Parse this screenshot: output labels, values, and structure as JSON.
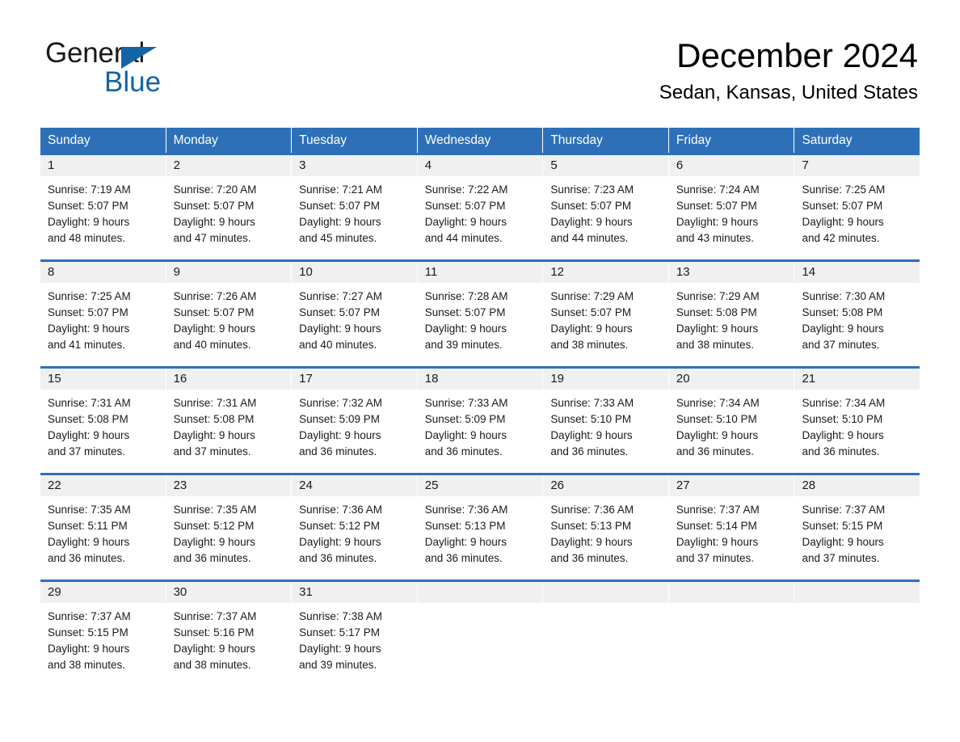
{
  "brand": {
    "name_part1": "General",
    "name_part2": "Blue",
    "accent_color": "#1464a5",
    "triangle_icon": "triangle-icon"
  },
  "header": {
    "month_title": "December 2024",
    "location": "Sedan, Kansas, United States"
  },
  "calendar": {
    "header_color": "#2e70b8",
    "day_band_color": "#f0f0f0",
    "weekdays": [
      "Sunday",
      "Monday",
      "Tuesday",
      "Wednesday",
      "Thursday",
      "Friday",
      "Saturday"
    ],
    "weeks": [
      [
        {
          "day": "1",
          "lines": [
            "Sunrise: 7:19 AM",
            "Sunset: 5:07 PM",
            "Daylight: 9 hours",
            "and 48 minutes."
          ]
        },
        {
          "day": "2",
          "lines": [
            "Sunrise: 7:20 AM",
            "Sunset: 5:07 PM",
            "Daylight: 9 hours",
            "and 47 minutes."
          ]
        },
        {
          "day": "3",
          "lines": [
            "Sunrise: 7:21 AM",
            "Sunset: 5:07 PM",
            "Daylight: 9 hours",
            "and 45 minutes."
          ]
        },
        {
          "day": "4",
          "lines": [
            "Sunrise: 7:22 AM",
            "Sunset: 5:07 PM",
            "Daylight: 9 hours",
            "and 44 minutes."
          ]
        },
        {
          "day": "5",
          "lines": [
            "Sunrise: 7:23 AM",
            "Sunset: 5:07 PM",
            "Daylight: 9 hours",
            "and 44 minutes."
          ]
        },
        {
          "day": "6",
          "lines": [
            "Sunrise: 7:24 AM",
            "Sunset: 5:07 PM",
            "Daylight: 9 hours",
            "and 43 minutes."
          ]
        },
        {
          "day": "7",
          "lines": [
            "Sunrise: 7:25 AM",
            "Sunset: 5:07 PM",
            "Daylight: 9 hours",
            "and 42 minutes."
          ]
        }
      ],
      [
        {
          "day": "8",
          "lines": [
            "Sunrise: 7:25 AM",
            "Sunset: 5:07 PM",
            "Daylight: 9 hours",
            "and 41 minutes."
          ]
        },
        {
          "day": "9",
          "lines": [
            "Sunrise: 7:26 AM",
            "Sunset: 5:07 PM",
            "Daylight: 9 hours",
            "and 40 minutes."
          ]
        },
        {
          "day": "10",
          "lines": [
            "Sunrise: 7:27 AM",
            "Sunset: 5:07 PM",
            "Daylight: 9 hours",
            "and 40 minutes."
          ]
        },
        {
          "day": "11",
          "lines": [
            "Sunrise: 7:28 AM",
            "Sunset: 5:07 PM",
            "Daylight: 9 hours",
            "and 39 minutes."
          ]
        },
        {
          "day": "12",
          "lines": [
            "Sunrise: 7:29 AM",
            "Sunset: 5:07 PM",
            "Daylight: 9 hours",
            "and 38 minutes."
          ]
        },
        {
          "day": "13",
          "lines": [
            "Sunrise: 7:29 AM",
            "Sunset: 5:08 PM",
            "Daylight: 9 hours",
            "and 38 minutes."
          ]
        },
        {
          "day": "14",
          "lines": [
            "Sunrise: 7:30 AM",
            "Sunset: 5:08 PM",
            "Daylight: 9 hours",
            "and 37 minutes."
          ]
        }
      ],
      [
        {
          "day": "15",
          "lines": [
            "Sunrise: 7:31 AM",
            "Sunset: 5:08 PM",
            "Daylight: 9 hours",
            "and 37 minutes."
          ]
        },
        {
          "day": "16",
          "lines": [
            "Sunrise: 7:31 AM",
            "Sunset: 5:08 PM",
            "Daylight: 9 hours",
            "and 37 minutes."
          ]
        },
        {
          "day": "17",
          "lines": [
            "Sunrise: 7:32 AM",
            "Sunset: 5:09 PM",
            "Daylight: 9 hours",
            "and 36 minutes."
          ]
        },
        {
          "day": "18",
          "lines": [
            "Sunrise: 7:33 AM",
            "Sunset: 5:09 PM",
            "Daylight: 9 hours",
            "and 36 minutes."
          ]
        },
        {
          "day": "19",
          "lines": [
            "Sunrise: 7:33 AM",
            "Sunset: 5:10 PM",
            "Daylight: 9 hours",
            "and 36 minutes."
          ]
        },
        {
          "day": "20",
          "lines": [
            "Sunrise: 7:34 AM",
            "Sunset: 5:10 PM",
            "Daylight: 9 hours",
            "and 36 minutes."
          ]
        },
        {
          "day": "21",
          "lines": [
            "Sunrise: 7:34 AM",
            "Sunset: 5:10 PM",
            "Daylight: 9 hours",
            "and 36 minutes."
          ]
        }
      ],
      [
        {
          "day": "22",
          "lines": [
            "Sunrise: 7:35 AM",
            "Sunset: 5:11 PM",
            "Daylight: 9 hours",
            "and 36 minutes."
          ]
        },
        {
          "day": "23",
          "lines": [
            "Sunrise: 7:35 AM",
            "Sunset: 5:12 PM",
            "Daylight: 9 hours",
            "and 36 minutes."
          ]
        },
        {
          "day": "24",
          "lines": [
            "Sunrise: 7:36 AM",
            "Sunset: 5:12 PM",
            "Daylight: 9 hours",
            "and 36 minutes."
          ]
        },
        {
          "day": "25",
          "lines": [
            "Sunrise: 7:36 AM",
            "Sunset: 5:13 PM",
            "Daylight: 9 hours",
            "and 36 minutes."
          ]
        },
        {
          "day": "26",
          "lines": [
            "Sunrise: 7:36 AM",
            "Sunset: 5:13 PM",
            "Daylight: 9 hours",
            "and 36 minutes."
          ]
        },
        {
          "day": "27",
          "lines": [
            "Sunrise: 7:37 AM",
            "Sunset: 5:14 PM",
            "Daylight: 9 hours",
            "and 37 minutes."
          ]
        },
        {
          "day": "28",
          "lines": [
            "Sunrise: 7:37 AM",
            "Sunset: 5:15 PM",
            "Daylight: 9 hours",
            "and 37 minutes."
          ]
        }
      ],
      [
        {
          "day": "29",
          "lines": [
            "Sunrise: 7:37 AM",
            "Sunset: 5:15 PM",
            "Daylight: 9 hours",
            "and 38 minutes."
          ]
        },
        {
          "day": "30",
          "lines": [
            "Sunrise: 7:37 AM",
            "Sunset: 5:16 PM",
            "Daylight: 9 hours",
            "and 38 minutes."
          ]
        },
        {
          "day": "31",
          "lines": [
            "Sunrise: 7:38 AM",
            "Sunset: 5:17 PM",
            "Daylight: 9 hours",
            "and 39 minutes."
          ]
        },
        {
          "day": "",
          "lines": []
        },
        {
          "day": "",
          "lines": []
        },
        {
          "day": "",
          "lines": []
        },
        {
          "day": "",
          "lines": []
        }
      ]
    ]
  }
}
